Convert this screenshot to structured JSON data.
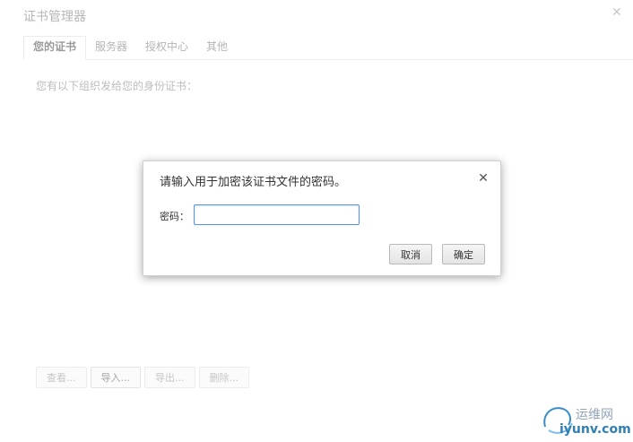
{
  "cert_manager": {
    "title": "证书管理器",
    "tabs": [
      "您的证书",
      "服务器",
      "授权中心",
      "其他"
    ],
    "description": "您有以下组织发给您的身份证书：",
    "actions": {
      "view": "查看...",
      "import": "导入...",
      "export": "导出...",
      "delete": "删除..."
    }
  },
  "dialog": {
    "title": "请输入用于加密该证书文件的密码。",
    "password_label": "密码：",
    "password_value": "",
    "cancel_label": "取消",
    "confirm_label": "确定"
  },
  "watermark": {
    "text_top": "运维网",
    "text_bottom": "iyunv.com"
  },
  "colors": {
    "focus_border": "#4d90fe",
    "faded_text": "#b7b7b7",
    "watermark_blue": "#2f7fb5"
  }
}
